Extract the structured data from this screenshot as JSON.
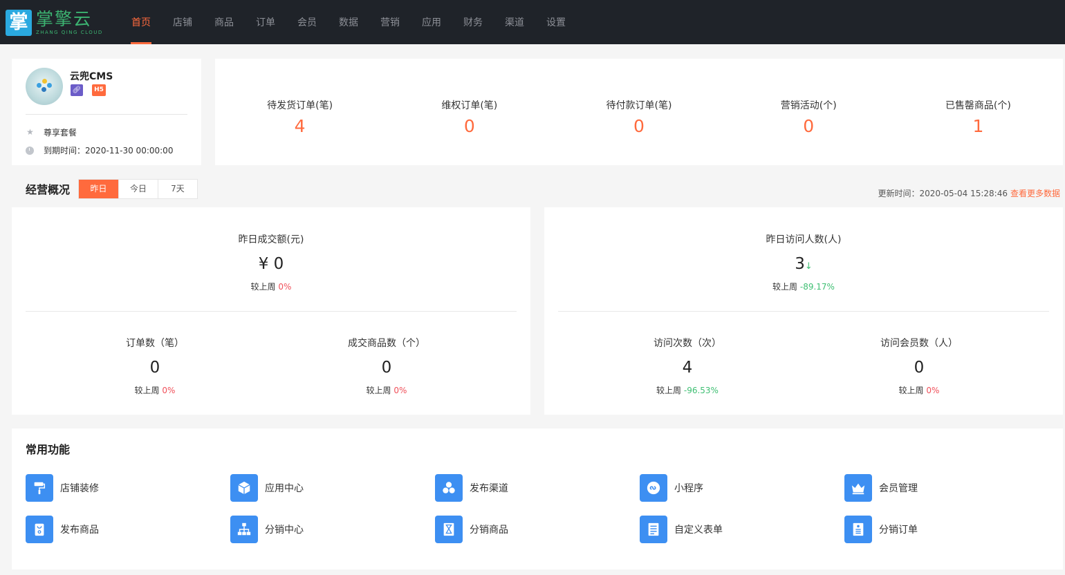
{
  "brand": {
    "logo_char": "掌",
    "name_cn": "掌擎云",
    "name_en": "ZHANG QING CLOUD"
  },
  "nav": [
    {
      "label": "首页",
      "active": true
    },
    {
      "label": "店铺"
    },
    {
      "label": "商品"
    },
    {
      "label": "订单"
    },
    {
      "label": "会员"
    },
    {
      "label": "数据"
    },
    {
      "label": "营销"
    },
    {
      "label": "应用"
    },
    {
      "label": "财务"
    },
    {
      "label": "渠道"
    },
    {
      "label": "设置"
    }
  ],
  "shop": {
    "name": "云兜CMS",
    "badge_h5": "H5",
    "package": "尊享套餐",
    "expire": "到期时间：2020-11-30 00:00:00"
  },
  "stats": [
    {
      "label": "待发货订单(笔)",
      "value": "4"
    },
    {
      "label": "维权订单(笔)",
      "value": "0"
    },
    {
      "label": "待付款订单(笔)",
      "value": "0"
    },
    {
      "label": "营销活动(个)",
      "value": "0"
    },
    {
      "label": "已售罄商品(个)",
      "value": "1"
    }
  ],
  "overview": {
    "title": "经营概况",
    "tabs": [
      "昨日",
      "今日",
      "7天"
    ],
    "update_time": "更新时间：2020-05-04 15:28:46",
    "more_link": "查看更多数据",
    "compare_label": "较上周",
    "left": {
      "main": {
        "label": "昨日成交额(元)",
        "value": "¥ 0",
        "change": "0%"
      },
      "sub": [
        {
          "label": "订单数（笔）",
          "value": "0",
          "change": "0%"
        },
        {
          "label": "成交商品数（个）",
          "value": "0",
          "change": "0%"
        }
      ]
    },
    "right": {
      "main": {
        "label": "昨日访问人数(人)",
        "value": "3",
        "arrow": "↓",
        "change": "-89.17%"
      },
      "sub": [
        {
          "label": "访问次数（次）",
          "value": "4",
          "change": "-96.53%"
        },
        {
          "label": "访问会员数（人）",
          "value": "0",
          "change": "0%"
        }
      ]
    }
  },
  "functions": {
    "title": "常用功能",
    "items": [
      {
        "label": "店铺装修",
        "icon": "paint-roller-icon"
      },
      {
        "label": "应用中心",
        "icon": "cube-icon"
      },
      {
        "label": "发布渠道",
        "icon": "hexagons-icon"
      },
      {
        "label": "小程序",
        "icon": "mini-program-icon"
      },
      {
        "label": "会员管理",
        "icon": "crown-icon"
      },
      {
        "label": "发布商品",
        "icon": "bag-icon"
      },
      {
        "label": "分销中心",
        "icon": "org-chart-icon"
      },
      {
        "label": "分销商品",
        "icon": "hourglass-icon"
      },
      {
        "label": "自定义表单",
        "icon": "form-icon"
      },
      {
        "label": "分销订单",
        "icon": "order-list-icon"
      }
    ]
  },
  "colors": {
    "accent": "#ff6a3d",
    "topbar": "#1f2329",
    "icon_blue": "#3d8ff2",
    "up_red": "#f0505a",
    "down_green": "#3fbf73"
  }
}
